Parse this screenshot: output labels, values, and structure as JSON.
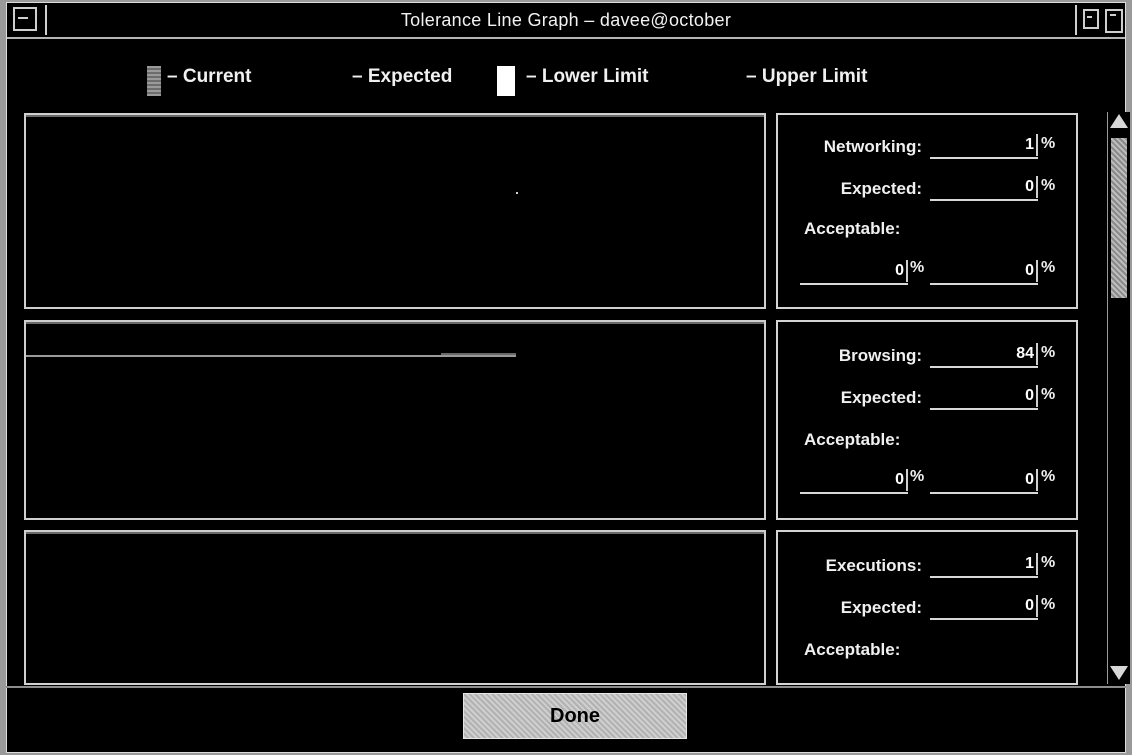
{
  "window": {
    "title": "Tolerance Line Graph – davee@october"
  },
  "legend": {
    "current": "– Current",
    "expected": "– Expected",
    "lower": "– Lower Limit",
    "upper": "– Upper Limit"
  },
  "panels": [
    {
      "label": "Networking:",
      "value": "1",
      "expected_label": "Expected:",
      "expected_value": "0",
      "acceptable_label": "Acceptable:",
      "acceptable_low": "0",
      "acceptable_high": "0",
      "pct": "%"
    },
    {
      "label": "Browsing:",
      "value": "84",
      "expected_label": "Expected:",
      "expected_value": "0",
      "acceptable_label": "Acceptable:",
      "acceptable_low": "0",
      "acceptable_high": "0",
      "pct": "%"
    },
    {
      "label": "Executions:",
      "value": "1",
      "expected_label": "Expected:",
      "expected_value": "0",
      "acceptable_label": "Acceptable:",
      "pct": "%"
    }
  ],
  "buttons": {
    "done": "Done"
  },
  "colors": {
    "background": "#000000",
    "frame": "#9a9a9a",
    "text": "#f0f0f0",
    "button": "#c2c2c2"
  }
}
